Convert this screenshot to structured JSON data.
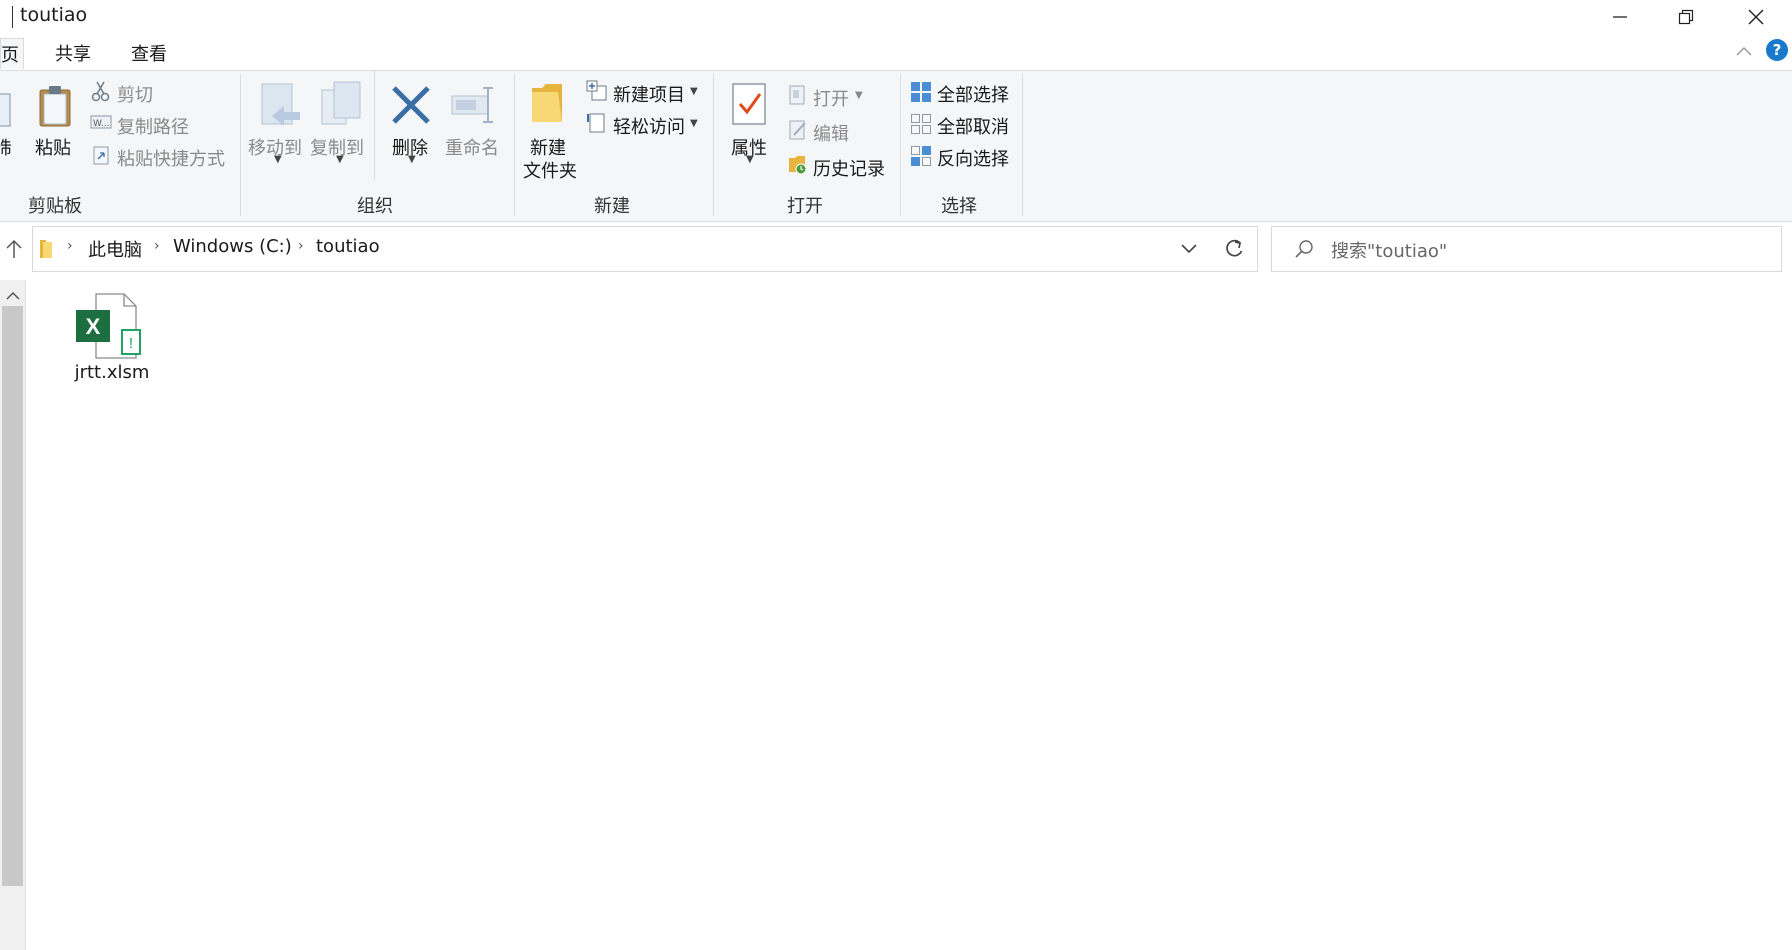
{
  "window": {
    "title": "toutiao"
  },
  "tabs": {
    "home": "页",
    "share": "共享",
    "view": "查看"
  },
  "clipboard": {
    "copy_partial": "制",
    "paste": "粘贴",
    "cut": "剪切",
    "copy_path": "复制路径",
    "paste_shortcut": "粘贴快捷方式",
    "group_label": "剪贴板"
  },
  "organize": {
    "move_to": "移动到",
    "copy_to": "复制到",
    "delete": "删除",
    "rename": "重命名",
    "group_label": "组织"
  },
  "new": {
    "new_folder_line1": "新建",
    "new_folder_line2": "文件夹",
    "new_item": "新建项目",
    "easy_access": "轻松访问",
    "group_label": "新建"
  },
  "open": {
    "properties": "属性",
    "open": "打开",
    "edit": "编辑",
    "history": "历史记录",
    "group_label": "打开"
  },
  "select": {
    "select_all": "全部选择",
    "select_none": "全部取消",
    "invert": "反向选择",
    "group_label": "选择"
  },
  "address": {
    "crumbs": [
      "此电脑",
      "Windows (C:)",
      "toutiao"
    ]
  },
  "search": {
    "placeholder": "搜索\"toutiao\""
  },
  "files": [
    {
      "name": "jrtt.xlsm"
    }
  ],
  "colors": {
    "excel_green": "#1d6f42",
    "accent_blue": "#1979ca",
    "delete_blue": "#3a6ea5"
  }
}
